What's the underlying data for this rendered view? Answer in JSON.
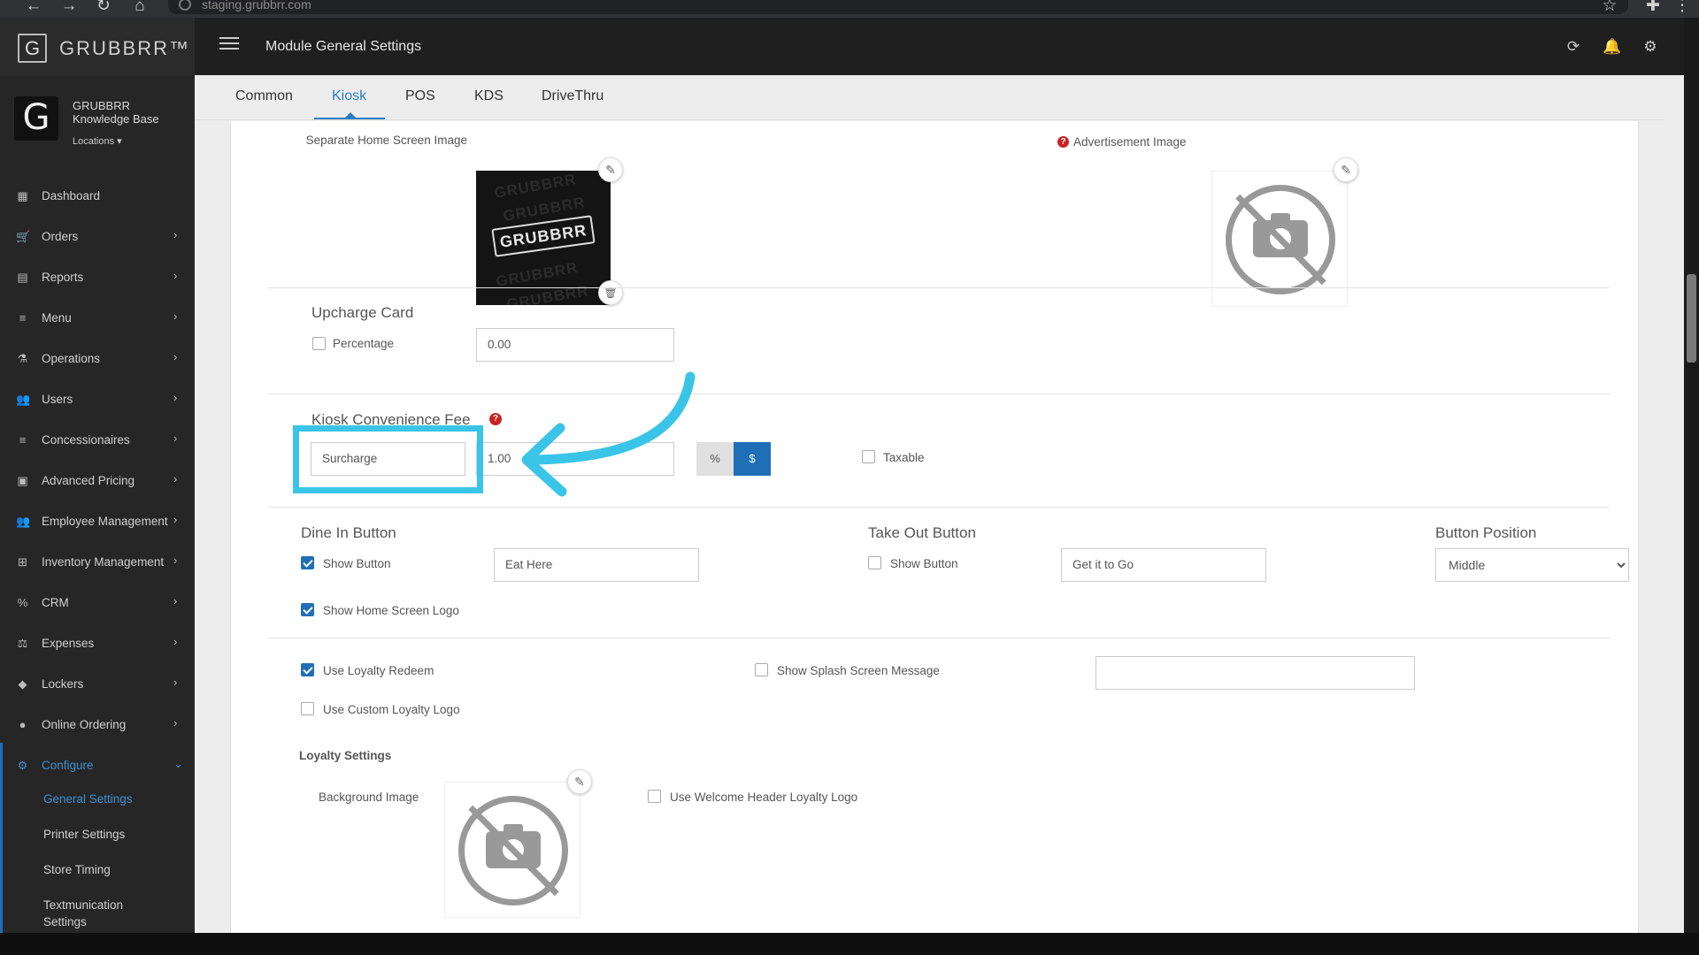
{
  "browser": {
    "url": "staging.grubbrr.com",
    "back_icon": "←",
    "forward_icon": "→",
    "reload_icon": "↻",
    "home_icon": "⌂",
    "star_icon": "☆",
    "extension_icon": "✚",
    "menu_icon": "⋮"
  },
  "header": {
    "brand": "GRUBBRR™",
    "brand_glyph": "G",
    "title": "Module General Settings",
    "refresh_icon": "⟳",
    "bell_icon": "🔔",
    "gear_icon": "⚙"
  },
  "sidebar": {
    "avatar_glyph": "G",
    "profile_name": "GRUBBRR Knowledge Base",
    "locations": "Locations ▾",
    "items": [
      {
        "label": "Dashboard",
        "icon": "▦",
        "chevron": ""
      },
      {
        "label": "Orders",
        "icon": "🛒",
        "chevron": "›"
      },
      {
        "label": "Reports",
        "icon": "▤",
        "chevron": "›"
      },
      {
        "label": "Menu",
        "icon": "≡",
        "chevron": "›"
      },
      {
        "label": "Operations",
        "icon": "⚗",
        "chevron": "›"
      },
      {
        "label": "Users",
        "icon": "👥",
        "chevron": "›"
      },
      {
        "label": "Concessionaires",
        "icon": "≡",
        "chevron": "›"
      },
      {
        "label": "Advanced Pricing",
        "icon": "▣",
        "chevron": "›"
      },
      {
        "label": "Employee Management",
        "icon": "👥",
        "chevron": "›"
      },
      {
        "label": "Inventory Management",
        "icon": "⊞",
        "chevron": "›"
      },
      {
        "label": "CRM",
        "icon": "%",
        "chevron": "›"
      },
      {
        "label": "Expenses",
        "icon": "⚖",
        "chevron": "›"
      },
      {
        "label": "Lockers",
        "icon": "◆",
        "chevron": "›"
      },
      {
        "label": "Online Ordering",
        "icon": "●",
        "chevron": "›"
      },
      {
        "label": "Configure",
        "icon": "⚙",
        "chevron": "⌄"
      }
    ],
    "sub_items": [
      "General Settings",
      "Printer Settings",
      "Store Timing",
      "Textmunication Settings"
    ]
  },
  "tabs": [
    "Common",
    "Kiosk",
    "POS",
    "KDS",
    "DriveThru"
  ],
  "form": {
    "home_image_label": "Separate Home Screen Image",
    "home_image_logo": "GRUBBRR",
    "home_image_watermark": "GRUBBRR",
    "advertisement_label": "Advertisement Image",
    "help_icon": "?",
    "pencil_icon": "✎",
    "trash_icon": "🗑",
    "upcharge": {
      "title": "Upcharge Card",
      "percentage_label": "Percentage",
      "value": "0.00"
    },
    "convenience": {
      "title": "Kiosk Convenience Fee",
      "name_value": "Surcharge",
      "amount": "1.00",
      "percent_label": "%",
      "dollar_label": "$",
      "taxable_label": "Taxable"
    },
    "dine_in": {
      "title": "Dine In Button",
      "show_label": "Show Button",
      "text_value": "Eat Here",
      "logo_label": "Show Home Screen Logo"
    },
    "take_out": {
      "title": "Take Out Button",
      "show_label": "Show Button",
      "text_value": "Get it to Go"
    },
    "button_position": {
      "title": "Button Position",
      "selected": "Middle"
    },
    "loyalty": {
      "use_redeem_label": "Use Loyalty Redeem",
      "splash_label": "Show Splash Screen Message",
      "splash_value": "",
      "custom_logo_label": "Use Custom Loyalty Logo",
      "settings_title": "Loyalty Settings",
      "background_label": "Background Image",
      "welcome_logo_label": "Use Welcome Header Loyalty Logo"
    }
  },
  "colors": {
    "accent": "#2a7fc4",
    "highlight": "#3ac5e8",
    "sidebar_bg": "#262626",
    "header_bg": "#1f1f1f"
  }
}
